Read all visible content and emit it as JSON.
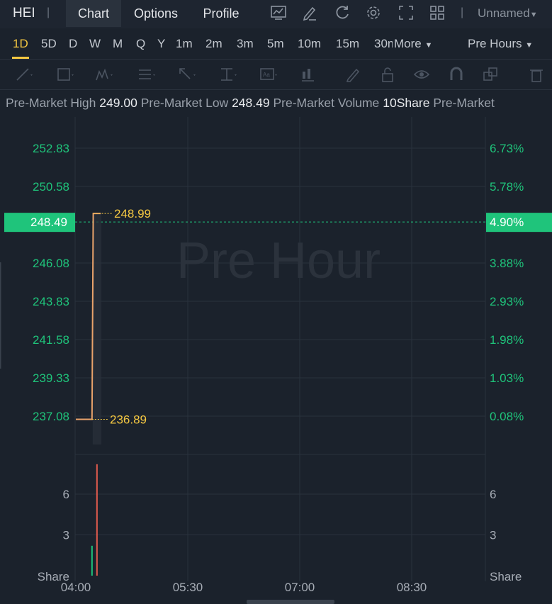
{
  "header": {
    "ticker": "HEI",
    "tabs": [
      "Chart",
      "Options",
      "Profile"
    ],
    "active_tab": "Chart",
    "layout_name": "Unnamed"
  },
  "timeframes": {
    "items": [
      "1D",
      "5D",
      "D",
      "W",
      "M",
      "Q",
      "Y",
      "1m",
      "2m",
      "3m",
      "5m",
      "10m",
      "15m",
      "30m"
    ],
    "more_label": "More",
    "active": "1D",
    "session_label": "Pre Hours"
  },
  "info": {
    "high_label": "Pre-Market High",
    "high_value": "249.00",
    "low_label": "Pre-Market Low",
    "low_value": "248.49",
    "volume_label": "Pre-Market Volume",
    "volume_value": "10Share",
    "trailing_label": "Pre-Market"
  },
  "colors": {
    "up": "#1fc47b",
    "down": "#e05a4d",
    "line": "#e9a36b",
    "label_yellow": "#f5c842",
    "price_tag": "#1fc47b"
  },
  "chart_data": {
    "type": "line",
    "watermark": "Pre Hour",
    "price_ticks": [
      "252.83",
      "250.58",
      "248.49",
      "246.08",
      "243.83",
      "241.58",
      "239.33",
      "237.08"
    ],
    "percent_ticks": [
      "6.73%",
      "5.78%",
      "4.90%",
      "3.88%",
      "2.93%",
      "1.98%",
      "1.03%",
      "0.08%"
    ],
    "current_price": "248.49",
    "current_percent": "4.90%",
    "high_marker": "248.99",
    "low_marker": "236.89",
    "x_ticks": [
      "04:00",
      "05:30",
      "07:00",
      "08:30"
    ],
    "series": [
      {
        "x": [
          "04:00",
          "04:13",
          "04:14",
          "04:20"
        ],
        "y": [
          236.89,
          236.89,
          248.99,
          248.99
        ]
      }
    ],
    "volume_ticks": [
      "6",
      "3"
    ],
    "volume_unit": "Share",
    "volume_bars": [
      {
        "time": "04:13",
        "value": 2.2,
        "direction": "up"
      },
      {
        "time": "04:17",
        "value": 8.2,
        "direction": "down"
      }
    ]
  }
}
